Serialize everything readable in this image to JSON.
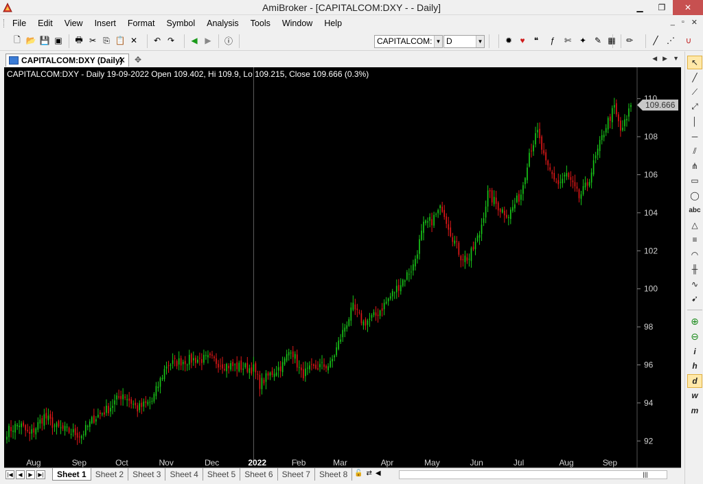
{
  "window": {
    "title": "AmiBroker - [CAPITALCOM:DXY -  - Daily]",
    "minimize": "▁",
    "restore": "❐",
    "close": "✕"
  },
  "menu": {
    "items": [
      "File",
      "Edit",
      "View",
      "Insert",
      "Format",
      "Symbol",
      "Analysis",
      "Tools",
      "Window",
      "Help"
    ],
    "mdi": [
      "_",
      "▫",
      "✕"
    ]
  },
  "toolbar": {
    "symbol_combo": "CAPITALCOM:",
    "interval_combo": "D",
    "left_icons": [
      "new-icon",
      "open-icon",
      "save-icon",
      "save-all-icon",
      "print-icon",
      "cut-icon",
      "copy-icon",
      "paste-icon",
      "delete-icon",
      "undo-icon",
      "redo-icon",
      "back-icon",
      "forward-icon",
      "info-icon"
    ],
    "right_icons": [
      "settings-icon",
      "heart-icon",
      "quote-icon",
      "formula-icon",
      "scissors-icon",
      "wand-icon",
      "note-icon",
      "image-icon",
      "pen-icon",
      "brush-icon",
      "dotted-line-icon",
      "magnet-icon"
    ]
  },
  "chart_tab": {
    "label": "CAPITALCOM:DXY (Daily)",
    "close": "✕",
    "new": "✥"
  },
  "chart_header": "CAPITALCOM:DXY - Daily 19-09-2022 Open 109.402, Hi 109.9, Lo 109.215, Close 109.666 (0.3%)",
  "price_label": "109.666",
  "sheets": {
    "items": [
      "Sheet 1",
      "Sheet 2",
      "Sheet 3",
      "Sheet 4",
      "Sheet 5",
      "Sheet 6",
      "Sheet 7",
      "Sheet 8"
    ],
    "active": 0
  },
  "colors": {
    "up": "#19c819",
    "down": "#e01818",
    "background": "#000000",
    "axis_text": "#d0d0d0",
    "grid": "#303030"
  },
  "chart_data": {
    "type": "candlestick",
    "symbol": "CAPITALCOM:DXY",
    "interval": "Daily",
    "y_range": [
      91,
      111
    ],
    "y_ticks": [
      92,
      94,
      96,
      98,
      100,
      102,
      104,
      106,
      108,
      110
    ],
    "x_labels": [
      {
        "label": "Aug",
        "idx": 12
      },
      {
        "label": "Sep",
        "idx": 34
      },
      {
        "label": "Oct",
        "idx": 55
      },
      {
        "label": "Nov",
        "idx": 76
      },
      {
        "label": "Dec",
        "idx": 98
      },
      {
        "label": "2022",
        "idx": 119,
        "bold": true
      },
      {
        "label": "Feb",
        "idx": 140
      },
      {
        "label": "Mar",
        "idx": 160
      },
      {
        "label": "Apr",
        "idx": 183
      },
      {
        "label": "May",
        "idx": 204
      },
      {
        "label": "Jun",
        "idx": 226
      },
      {
        "label": "Jul",
        "idx": 247
      },
      {
        "label": "Aug",
        "idx": 269
      },
      {
        "label": "Sep",
        "idx": 290
      }
    ],
    "crosshair_idx": 119,
    "last_close": 109.666,
    "anchors": [
      [
        0,
        92.5
      ],
      [
        6,
        92.9
      ],
      [
        11,
        92.3
      ],
      [
        18,
        93.3
      ],
      [
        24,
        92.7
      ],
      [
        30,
        92.5
      ],
      [
        36,
        92.3
      ],
      [
        42,
        93.2
      ],
      [
        49,
        93.7
      ],
      [
        56,
        94.5
      ],
      [
        63,
        93.7
      ],
      [
        70,
        94.1
      ],
      [
        77,
        96.0
      ],
      [
        84,
        96.2
      ],
      [
        91,
        96.3
      ],
      [
        98,
        96.3
      ],
      [
        105,
        96.0
      ],
      [
        112,
        95.9
      ],
      [
        119,
        95.8
      ],
      [
        122,
        95.0
      ],
      [
        128,
        95.6
      ],
      [
        133,
        96.0
      ],
      [
        137,
        96.9
      ],
      [
        142,
        95.5
      ],
      [
        150,
        95.9
      ],
      [
        156,
        96.0
      ],
      [
        163,
        98.0
      ],
      [
        167,
        99.0
      ],
      [
        172,
        98.2
      ],
      [
        178,
        98.6
      ],
      [
        185,
        99.6
      ],
      [
        190,
        100.3
      ],
      [
        196,
        101.2
      ],
      [
        201,
        103.3
      ],
      [
        205,
        103.6
      ],
      [
        210,
        104.3
      ],
      [
        214,
        103.0
      ],
      [
        219,
        101.7
      ],
      [
        223,
        101.6
      ],
      [
        228,
        102.9
      ],
      [
        232,
        105.0
      ],
      [
        238,
        104.2
      ],
      [
        242,
        103.9
      ],
      [
        248,
        105.0
      ],
      [
        252,
        107.2
      ],
      [
        256,
        108.2
      ],
      [
        260,
        106.5
      ],
      [
        266,
        105.5
      ],
      [
        270,
        106.0
      ],
      [
        276,
        104.8
      ],
      [
        280,
        105.5
      ],
      [
        284,
        106.9
      ],
      [
        289,
        108.6
      ],
      [
        293,
        109.5
      ],
      [
        296,
        108.3
      ],
      [
        299,
        108.9
      ],
      [
        301,
        109.666
      ]
    ]
  }
}
